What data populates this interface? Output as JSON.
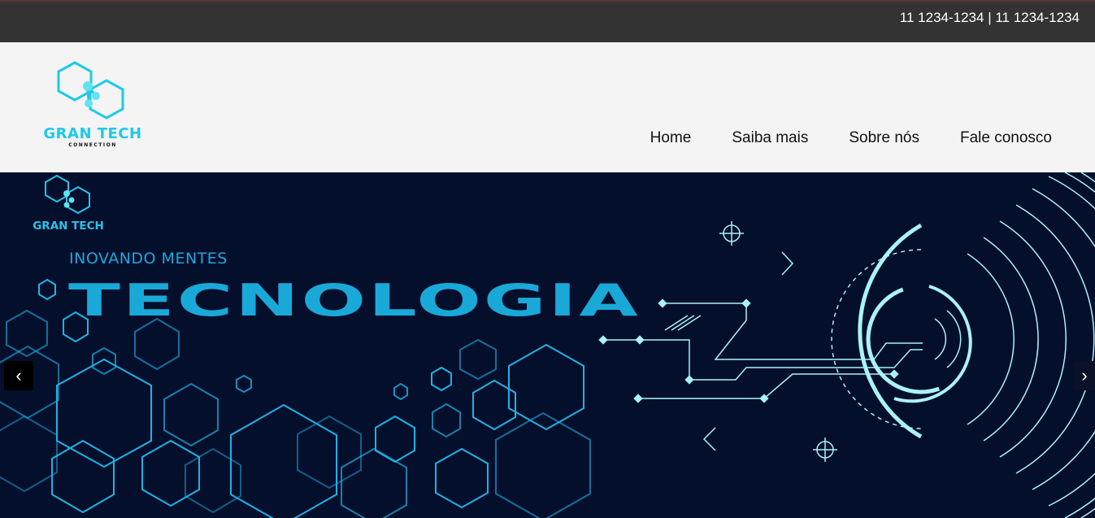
{
  "topbar": {
    "phones": "11 1234-1234 | 11 1234-1234"
  },
  "header": {
    "logo": {
      "brand": "GRAN TECH",
      "sub": "CONNECTION"
    },
    "nav": [
      {
        "label": "Home"
      },
      {
        "label": "Saiba mais"
      },
      {
        "label": "Sobre nós"
      },
      {
        "label": "Fale conosco"
      }
    ]
  },
  "hero": {
    "logo_brand": "GRAN TECH",
    "tagline": "INOVANDO MENTES",
    "headline": "TECNOLOGIA",
    "prev_arrow": "‹",
    "next_arrow": "›"
  },
  "colors": {
    "topbar": "#333333",
    "header": "#f4f4f4",
    "hero_bg": "#040f2c",
    "accent": "#1ec9e8",
    "circuit": "#a9f3f6"
  }
}
